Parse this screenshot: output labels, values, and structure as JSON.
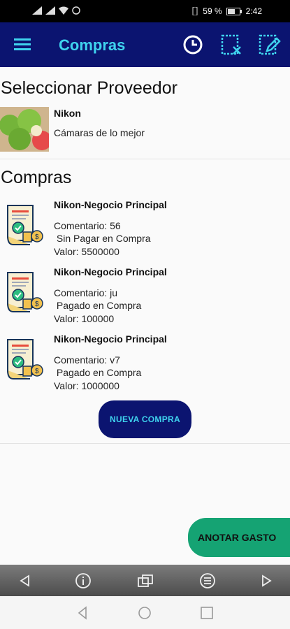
{
  "status_bar": {
    "battery": "59 %",
    "time": "2:42"
  },
  "app_bar": {
    "title": "Compras"
  },
  "supplier_section": {
    "title": "Seleccionar Proveedor",
    "supplier": {
      "name": "Nikon",
      "description": "Cámaras de lo mejor"
    }
  },
  "purchases_section": {
    "title": "Compras",
    "items": [
      {
        "title": "Nikon-Negocio Principal",
        "comment": "Comentario: 56",
        "status": " Sin Pagar en Compra",
        "value": "Valor: 5500000"
      },
      {
        "title": "Nikon-Negocio Principal",
        "comment": "Comentario: ju",
        "status": " Pagado en Compra",
        "value": "Valor: 100000"
      },
      {
        "title": "Nikon-Negocio Principal",
        "comment": "Comentario: v7",
        "status": " Pagado en Compra",
        "value": "Valor: 1000000"
      }
    ],
    "new_button": "NUEVA COMPRA"
  },
  "fab": {
    "label": "ANOTAR GASTO"
  },
  "colors": {
    "app_bar": "#0b1470",
    "accent": "#3fd3ee",
    "fab": "#15a373"
  }
}
